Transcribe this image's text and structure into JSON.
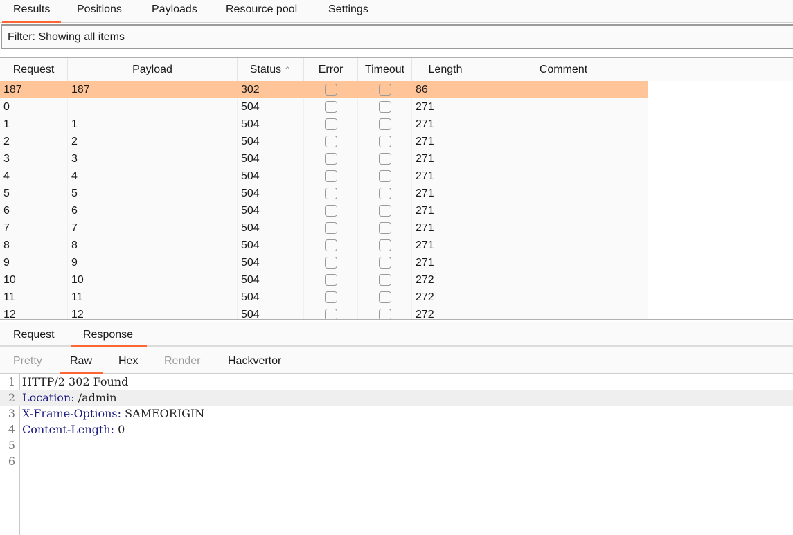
{
  "top_tabs": [
    "Results",
    "Positions",
    "Payloads",
    "Resource pool",
    "Settings"
  ],
  "active_top_tab": "Results",
  "filter": {
    "label": "Filter: Showing all items"
  },
  "table": {
    "columns": [
      "Request",
      "Payload",
      "Status",
      "Error",
      "Timeout",
      "Length",
      "Comment"
    ],
    "sorted_column": "Status",
    "sort_direction": "ascending",
    "sort_icon": "chevron-up-icon",
    "rows": [
      {
        "request": "187",
        "payload": "187",
        "status": "302",
        "error": false,
        "timeout": false,
        "length": "86",
        "comment": "",
        "selected": true
      },
      {
        "request": "0",
        "payload": "",
        "status": "504",
        "error": false,
        "timeout": false,
        "length": "271",
        "comment": ""
      },
      {
        "request": "1",
        "payload": "1",
        "status": "504",
        "error": false,
        "timeout": false,
        "length": "271",
        "comment": ""
      },
      {
        "request": "2",
        "payload": "2",
        "status": "504",
        "error": false,
        "timeout": false,
        "length": "271",
        "comment": ""
      },
      {
        "request": "3",
        "payload": "3",
        "status": "504",
        "error": false,
        "timeout": false,
        "length": "271",
        "comment": ""
      },
      {
        "request": "4",
        "payload": "4",
        "status": "504",
        "error": false,
        "timeout": false,
        "length": "271",
        "comment": ""
      },
      {
        "request": "5",
        "payload": "5",
        "status": "504",
        "error": false,
        "timeout": false,
        "length": "271",
        "comment": ""
      },
      {
        "request": "6",
        "payload": "6",
        "status": "504",
        "error": false,
        "timeout": false,
        "length": "271",
        "comment": ""
      },
      {
        "request": "7",
        "payload": "7",
        "status": "504",
        "error": false,
        "timeout": false,
        "length": "271",
        "comment": ""
      },
      {
        "request": "8",
        "payload": "8",
        "status": "504",
        "error": false,
        "timeout": false,
        "length": "271",
        "comment": ""
      },
      {
        "request": "9",
        "payload": "9",
        "status": "504",
        "error": false,
        "timeout": false,
        "length": "271",
        "comment": ""
      },
      {
        "request": "10",
        "payload": "10",
        "status": "504",
        "error": false,
        "timeout": false,
        "length": "272",
        "comment": ""
      },
      {
        "request": "11",
        "payload": "11",
        "status": "504",
        "error": false,
        "timeout": false,
        "length": "272",
        "comment": ""
      },
      {
        "request": "12",
        "payload": "12",
        "status": "504",
        "error": false,
        "timeout": false,
        "length": "272",
        "comment": ""
      }
    ]
  },
  "message_tabs": [
    "Request",
    "Response"
  ],
  "active_message_tab": "Response",
  "view_tabs": [
    {
      "label": "Pretty",
      "enabled": false
    },
    {
      "label": "Raw",
      "enabled": true
    },
    {
      "label": "Hex",
      "enabled": true
    },
    {
      "label": "Render",
      "enabled": false
    },
    {
      "label": "Hackvertor",
      "enabled": true
    }
  ],
  "active_view_tab": "Raw",
  "response_lines": [
    {
      "n": "1",
      "name": "",
      "value": "HTTP/2 302 Found"
    },
    {
      "n": "2",
      "name": "Location",
      "value": " /admin"
    },
    {
      "n": "3",
      "name": "X-Frame-Options",
      "value": " SAMEORIGIN"
    },
    {
      "n": "4",
      "name": "Content-Length",
      "value": " 0"
    },
    {
      "n": "5",
      "name": "",
      "value": ""
    },
    {
      "n": "6",
      "name": "",
      "value": ""
    }
  ],
  "highlighted_line": "2",
  "colors": {
    "accent": "#ff6633",
    "selected_row": "#ffc599",
    "header_name": "#1a1a80"
  }
}
